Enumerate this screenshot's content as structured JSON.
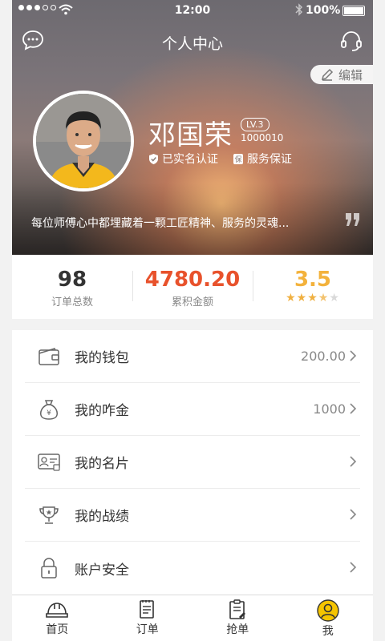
{
  "status_bar": {
    "time": "12:00",
    "battery": "100%"
  },
  "header": {
    "title": "个人中心",
    "edit_label": "编辑",
    "icons": {
      "left": "chat-bubble-icon",
      "right": "headset-icon"
    }
  },
  "profile": {
    "name": "邓国荣",
    "level": "LV.3",
    "user_id": "1000010",
    "verified": "已实名认证",
    "guarantee": "服务保证",
    "motto": "每位师傅心中都埋藏着一颗工匠精神、服务的灵魂..."
  },
  "stats": [
    {
      "value": "98",
      "label": "订单总数"
    },
    {
      "value": "4780.20",
      "label": "累积金额"
    },
    {
      "value": "3.5",
      "rating": 3.5,
      "max": 5
    }
  ],
  "menu": [
    {
      "label": "我的钱包",
      "value": "200.00",
      "icon": "wallet-icon"
    },
    {
      "label": "我的咋金",
      "value": "1000",
      "icon": "money-bag-icon"
    },
    {
      "label": "我的名片",
      "value": "",
      "icon": "business-card-icon"
    },
    {
      "label": "我的战绩",
      "value": "",
      "icon": "trophy-icon"
    },
    {
      "label": "账户安全",
      "value": "",
      "icon": "lock-icon"
    }
  ],
  "tabbar": [
    {
      "label": "首页",
      "icon": "hardhat-icon"
    },
    {
      "label": "订单",
      "icon": "document-icon"
    },
    {
      "label": "抢单",
      "icon": "clipboard-icon"
    },
    {
      "label": "我",
      "icon": "user-icon",
      "active": true
    }
  ],
  "colors": {
    "accent_amount": "#e8522c",
    "accent_rating": "#f3b23c",
    "active_tab": "#f5c400"
  }
}
